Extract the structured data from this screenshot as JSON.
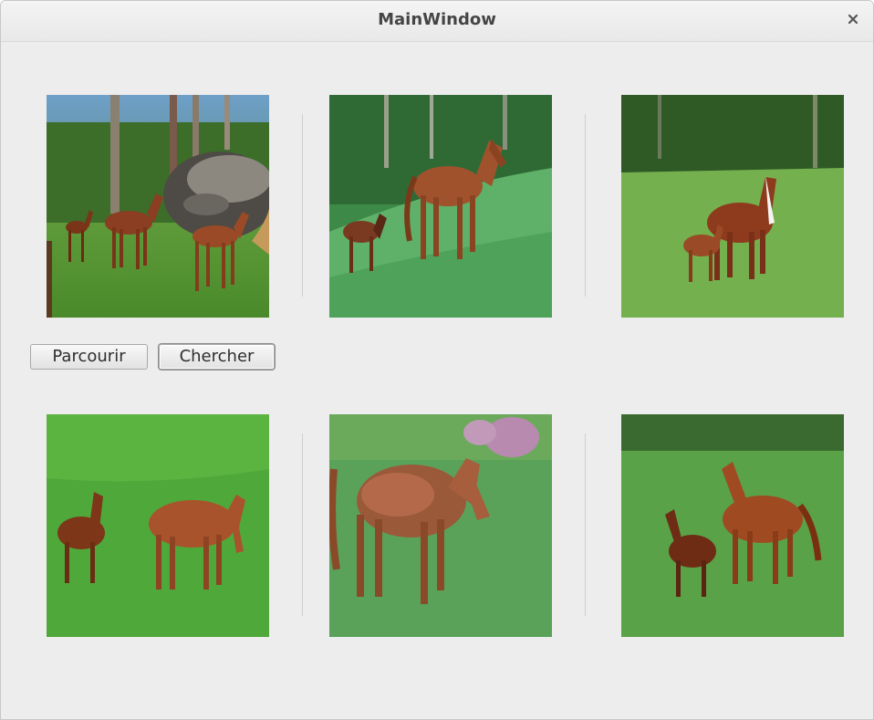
{
  "window": {
    "title": "MainWindow",
    "close_icon": "close-icon"
  },
  "toolbar": {
    "browse_label": "Parcourir",
    "search_label": "Chercher"
  },
  "gallery": {
    "images": [
      {
        "name": "horse-image-1",
        "description": "horses by a large rock in a forest meadow"
      },
      {
        "name": "horse-image-2",
        "description": "mare and foal on a grassy slope"
      },
      {
        "name": "horse-image-3",
        "description": "mare and foal in tall grass"
      },
      {
        "name": "horse-image-4",
        "description": "foal and mare grazing in green grass"
      },
      {
        "name": "horse-image-5",
        "description": "chestnut horse in tall grass"
      },
      {
        "name": "horse-image-6",
        "description": "foal and mare trotting in a meadow"
      }
    ]
  },
  "colors": {
    "window_bg": "#ededed",
    "titlebar_text": "#454545",
    "grass": "#4fa83a",
    "horse": "#a0522d"
  }
}
